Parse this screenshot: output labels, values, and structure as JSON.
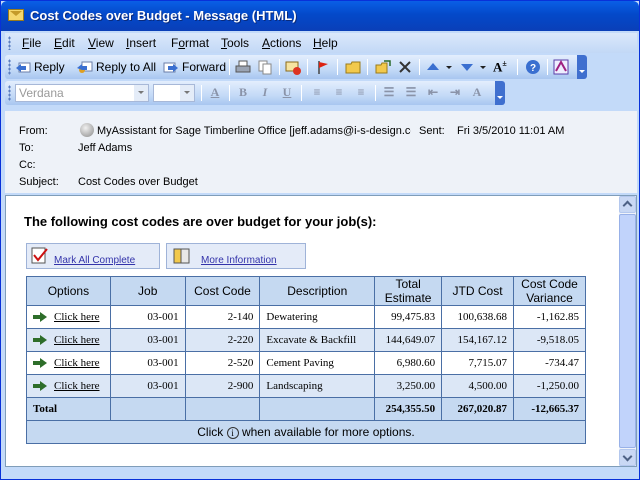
{
  "window": {
    "title": "Cost Codes over Budget - Message (HTML)"
  },
  "menu": [
    {
      "label": "File",
      "key": "F",
      "rest": "ile"
    },
    {
      "label": "Edit",
      "key": "E",
      "rest": "dit"
    },
    {
      "label": "View",
      "key": "V",
      "rest": "iew"
    },
    {
      "label": "Insert",
      "key": "I",
      "rest": "nsert"
    },
    {
      "label": "Format",
      "key": "o",
      "pre": "F",
      "rest": "rmat"
    },
    {
      "label": "Tools",
      "key": "T",
      "rest": "ools"
    },
    {
      "label": "Actions",
      "key": "A",
      "rest": "ctions"
    },
    {
      "label": "Help",
      "key": "H",
      "rest": "elp"
    }
  ],
  "toolbar": {
    "reply": "Reply",
    "reply_all": "Reply to All",
    "forward": "Forward"
  },
  "format_bar": {
    "font": "Verdana",
    "size": ""
  },
  "header": {
    "from_label": "From:",
    "from_value": "MyAssistant for Sage Timberline Office [jeff.adams@i-s-design.cc",
    "sent_label": "Sent:",
    "sent_value": "Fri 3/5/2010 11:01 AM",
    "to_label": "To:",
    "to_value": "Jeff Adams",
    "cc_label": "Cc:",
    "cc_value": "",
    "subject_label": "Subject:",
    "subject_value": "Cost Codes over Budget"
  },
  "message": {
    "heading": "The following cost codes are over budget for your job(s):",
    "mark_all": "Mark All Complete",
    "more_info": "More Information",
    "columns": [
      "Options",
      "Job",
      "Cost Code",
      "Description",
      "Total Estimate",
      "JTD Cost",
      "Cost Code Variance"
    ],
    "rows": [
      {
        "option": "Click here",
        "job": "03-001",
        "code": "2-140",
        "desc": "Dewatering",
        "estimate": "99,475.83",
        "jtd": "100,638.68",
        "variance": "-1,162.85"
      },
      {
        "option": "Click here",
        "job": "03-001",
        "code": "2-220",
        "desc": "Excavate & Backfill",
        "estimate": "144,649.07",
        "jtd": "154,167.12",
        "variance": "-9,518.05"
      },
      {
        "option": "Click here",
        "job": "03-001",
        "code": "2-520",
        "desc": "Cement Paving",
        "estimate": "6,980.60",
        "jtd": "7,715.07",
        "variance": "-734.47"
      },
      {
        "option": "Click here",
        "job": "03-001",
        "code": "2-900",
        "desc": "Landscaping",
        "estimate": "3,250.00",
        "jtd": "4,500.00",
        "variance": "-1,250.00"
      }
    ],
    "total_label": "Total",
    "total_estimate": "254,355.50",
    "total_jtd": "267,020.87",
    "total_variance": "-12,665.37",
    "footer_pre": "Click",
    "footer_icon": "i",
    "footer_post": "when available for more options."
  }
}
